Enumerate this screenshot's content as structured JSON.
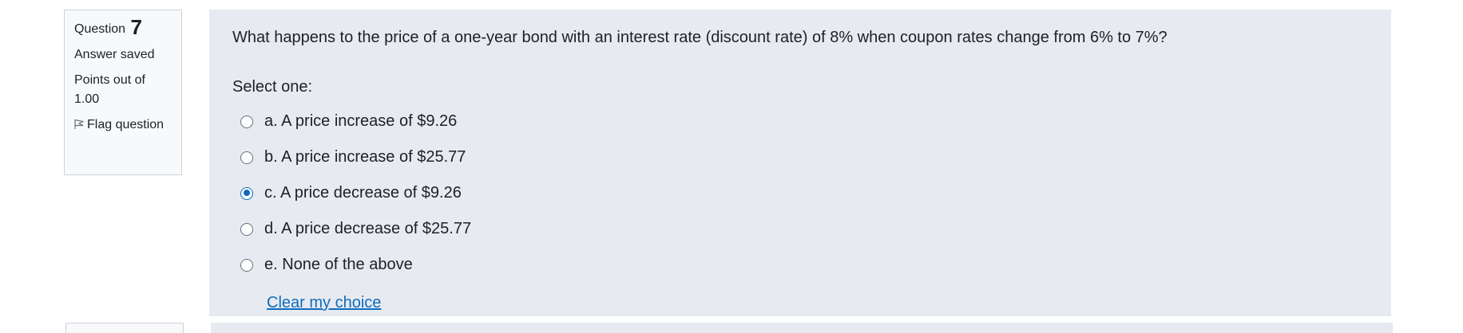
{
  "question_info": {
    "label": "Question",
    "number": "7",
    "state": "Answer saved",
    "grade": "Points out of 1.00",
    "flag_label": "Flag question"
  },
  "question": {
    "text": "What happens to the price of a one-year bond with an interest rate (discount rate) of 8% when coupon rates change from 6% to 7%?",
    "prompt": "Select one:",
    "options": [
      {
        "label": "a. A price increase of $9.26",
        "selected": false
      },
      {
        "label": "b. A price increase of $25.77",
        "selected": false
      },
      {
        "label": "c. A price decrease of $9.26",
        "selected": true
      },
      {
        "label": "d. A price decrease of $25.77",
        "selected": false
      },
      {
        "label": "e. None of the above",
        "selected": false
      }
    ],
    "clear_label": "Clear my choice"
  },
  "colors": {
    "accent": "#0f6cbf",
    "content_bg": "#e7eaf0",
    "info_bg": "#f8f9fa"
  }
}
